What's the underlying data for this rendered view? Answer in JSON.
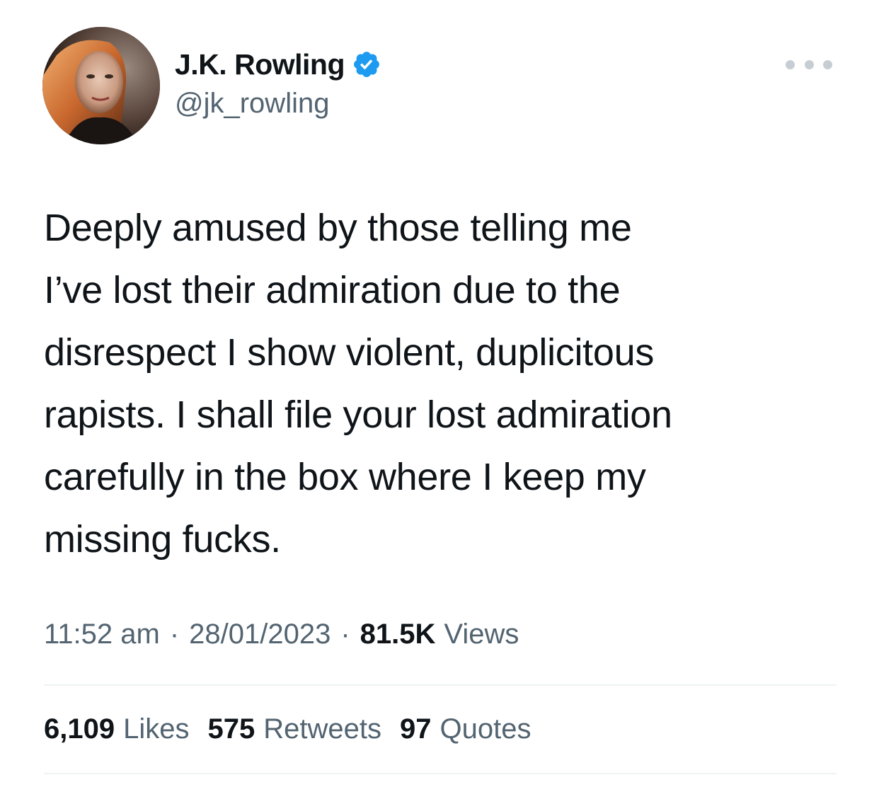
{
  "author": {
    "display_name": "J.K. Rowling",
    "handle": "@jk_rowling",
    "verified_color": "#1d9bf0"
  },
  "tweet": {
    "text": "Deeply amused by those telling me\nI’ve lost their admiration due to the\ndisrespect I show violent, duplicitous\nrapists. I shall file your lost admiration\ncarefully in the box where I keep my\nmissing fucks."
  },
  "meta": {
    "time": "11:52 am",
    "separator": "·",
    "date": "28/01/2023",
    "views_count": "81.5K",
    "views_label": "Views"
  },
  "stats": {
    "likes_count": "6,109",
    "likes_label": "Likes",
    "retweets_count": "575",
    "retweets_label": "Retweets",
    "quotes_count": "97",
    "quotes_label": "Quotes"
  },
  "icons": {
    "more": "more-options-icon",
    "verified": "verified-badge-icon"
  }
}
